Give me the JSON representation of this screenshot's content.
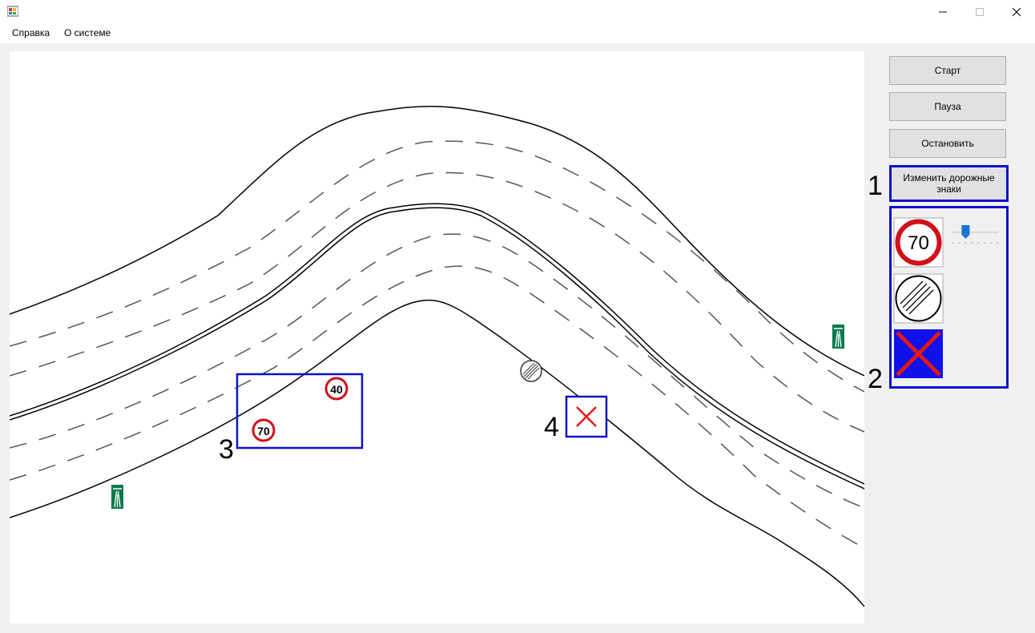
{
  "window": {
    "minimize_icon": "minimize-icon",
    "maximize_icon": "maximize-icon",
    "close_icon": "close-icon"
  },
  "menu": {
    "items": [
      "Справка",
      "О системе"
    ]
  },
  "controls": {
    "start_label": "Старт",
    "pause_label": "Пауза",
    "stop_label": "Остановить",
    "change_signs_label": "Изменить дорожные знаки"
  },
  "sign_panel": {
    "speed_limit_value": "70",
    "slider_level": 0.3,
    "signs": [
      "speed-limit-70-sign",
      "end-of-restrictions-sign",
      "remove-sign"
    ]
  },
  "canvas_signs": {
    "speed_limit_a": "40",
    "speed_limit_b": "70"
  },
  "callouts": {
    "c1": "1",
    "c2": "2",
    "c3": "3",
    "c4": "4"
  },
  "colors": {
    "highlight": "#1010c8",
    "sign_red": "#d0101a",
    "highway_green": "#0b7a4b",
    "slider_blue": "#1a74d6"
  }
}
